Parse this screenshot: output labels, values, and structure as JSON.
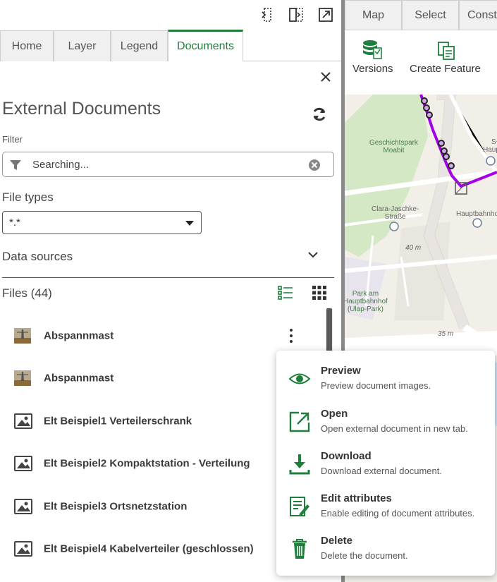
{
  "colors": {
    "accent": "#1d7f3b",
    "route": "#a400e6",
    "map_bg": "#f2efe9",
    "park": "#d5e8c5"
  },
  "left_tabs": [
    "Home",
    "Layer",
    "Legend",
    "Documents"
  ],
  "right_tabs": [
    "Map",
    "Select",
    "Const"
  ],
  "ribbon": {
    "versions": "Versions",
    "create_feature": "Create Feature"
  },
  "panel": {
    "title": "External Documents",
    "filter_label": "Filter",
    "filter_placeholder": "Searching...",
    "file_types_label": "File types",
    "file_types_value": "*.*",
    "data_sources_label": "Data sources",
    "files_label": "Files (44)"
  },
  "files": [
    {
      "name": "Abspannmast",
      "thumb": "photo"
    },
    {
      "name": "Abspannmast",
      "thumb": "photo"
    },
    {
      "name": "Elt Beispiel1 Verteilerschrank",
      "thumb": "image-icon"
    },
    {
      "name": "Elt Beispiel2 Kompaktstation - Verteilung",
      "thumb": "image-icon"
    },
    {
      "name": "Elt Beispiel3 Ortsnetzstation",
      "thumb": "image-icon"
    },
    {
      "name": "Elt Beispiel4 Kabelverteiler (geschlossen)",
      "thumb": "image-icon"
    }
  ],
  "context_menu": [
    {
      "title": "Preview",
      "desc": "Preview document images.",
      "icon": "eye-icon"
    },
    {
      "title": "Open",
      "desc": "Open external document in new tab.",
      "icon": "open-external-icon"
    },
    {
      "title": "Download",
      "desc": "Download external document.",
      "icon": "download-icon"
    },
    {
      "title": "Edit attributes",
      "desc": "Enable editing of document attributes.",
      "icon": "edit-attributes-icon"
    },
    {
      "title": "Delete",
      "desc": "Delete the document.",
      "icon": "trash-icon"
    }
  ],
  "map_labels": {
    "geschichtspark": "Geschichtspark\nMoabit",
    "s_u": "S+U\nHauptbah",
    "clara": "Clara-Jaschke-\nStraße",
    "hauptbahnhof": "Hauptbahnhof",
    "elev40": "40 m",
    "park_am": "Park am\nHauptbahnhof\n(Ulap-Park)",
    "elev35": "35 m"
  }
}
